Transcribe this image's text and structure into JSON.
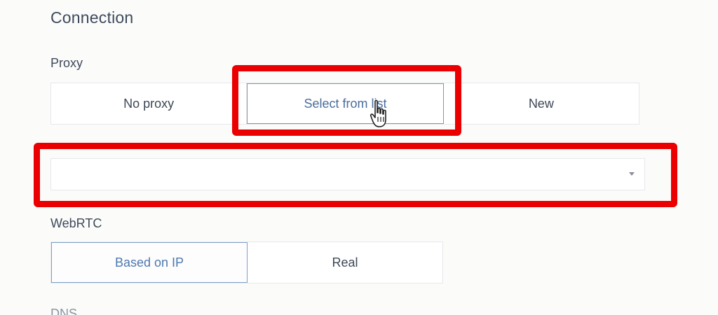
{
  "section": {
    "title": "Connection"
  },
  "proxy": {
    "label": "Proxy",
    "options": [
      "No proxy",
      "Select from list",
      "New"
    ],
    "selected": "Select from list",
    "dropdown": {
      "value": "",
      "placeholder": ""
    }
  },
  "webrtc": {
    "label": "WebRTC",
    "options": [
      "Based on IP",
      "Real"
    ],
    "selected": "Based on IP"
  },
  "dns": {
    "label": "DNS"
  },
  "annotations": {
    "highlight_color": "#ea0000"
  },
  "icons": {
    "cursor": "hand-pointer-icon",
    "dropdown": "caret-down-icon"
  }
}
